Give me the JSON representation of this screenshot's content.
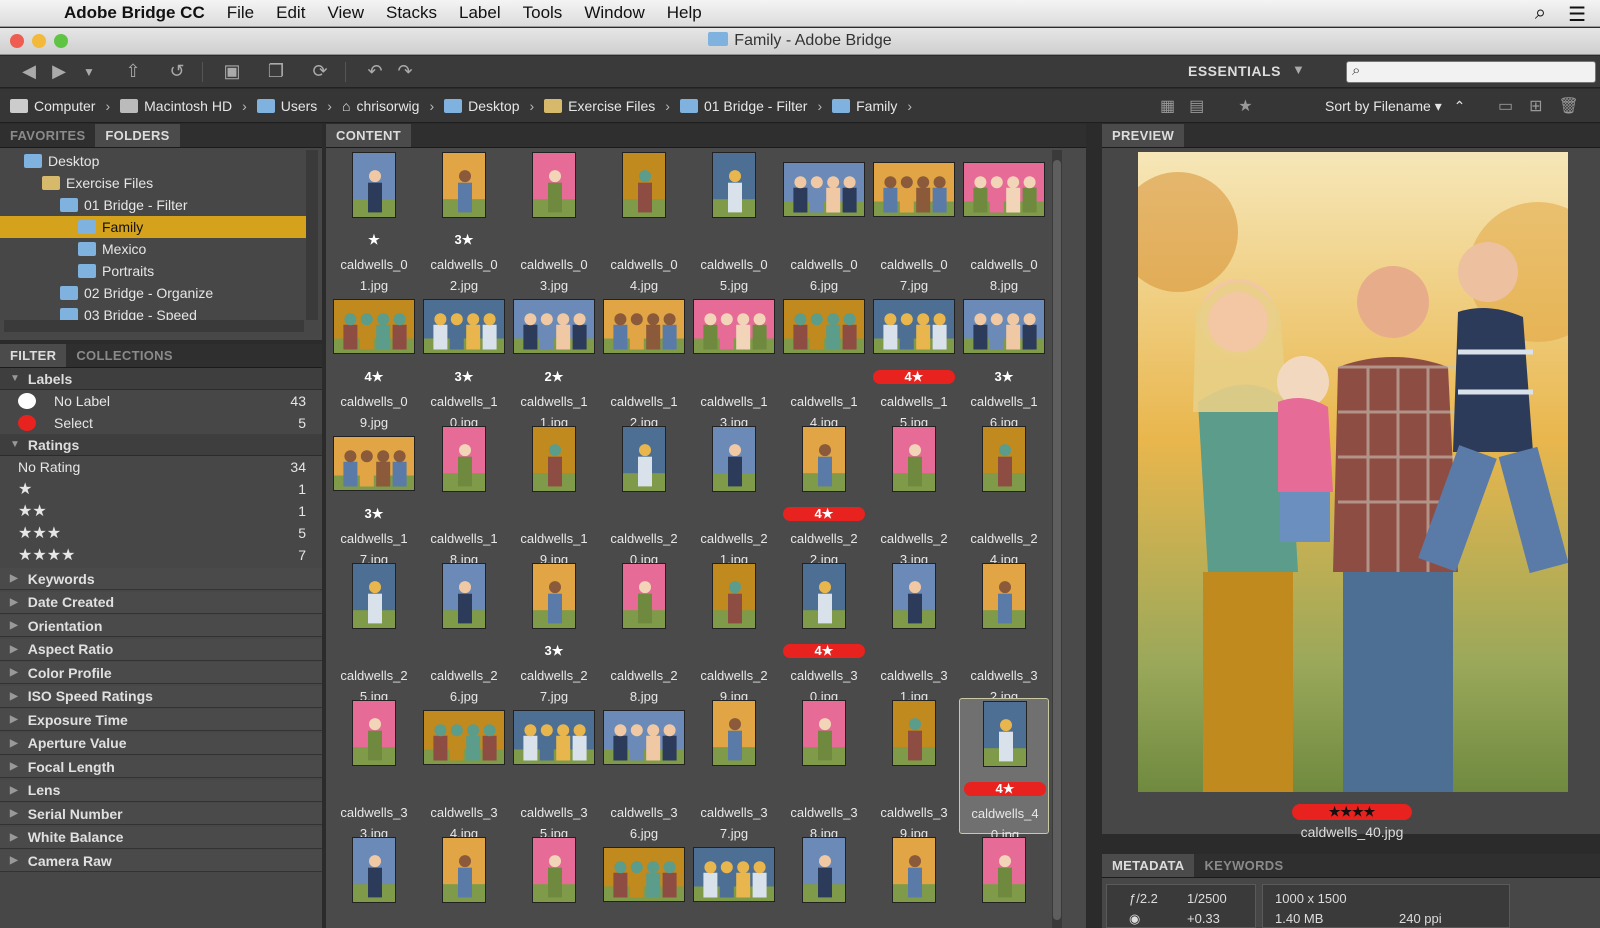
{
  "menubar": {
    "app_name": "Adobe Bridge CC",
    "items": [
      "File",
      "Edit",
      "View",
      "Stacks",
      "Label",
      "Tools",
      "Window",
      "Help"
    ]
  },
  "window": {
    "title": "Family - Adobe Bridge"
  },
  "toolbar": {
    "workspace": "ESSENTIALS",
    "search_value": ""
  },
  "path": [
    "Computer",
    "Macintosh HD",
    "Users",
    "chrisorwig",
    "Desktop",
    "Exercise Files",
    "01 Bridge - Filter",
    "Family"
  ],
  "sort_label": "Sort by Filename",
  "left_top": {
    "tabs": [
      "FAVORITES",
      "FOLDERS"
    ],
    "tree": [
      {
        "label": "Desktop",
        "indent": 0
      },
      {
        "label": "Exercise Files",
        "indent": 1
      },
      {
        "label": "01 Bridge - Filter",
        "indent": 2
      },
      {
        "label": "Family",
        "indent": 3,
        "selected": true
      },
      {
        "label": "Mexico",
        "indent": 3
      },
      {
        "label": "Portraits",
        "indent": 3
      },
      {
        "label": "02 Bridge - Organize",
        "indent": 2
      },
      {
        "label": "03 Bridge - Speed",
        "indent": 2
      }
    ]
  },
  "filter": {
    "tabs": [
      "FILTER",
      "COLLECTIONS"
    ],
    "labels_heading": "Labels",
    "labels": [
      {
        "label": "No Label",
        "count": "43",
        "color": "#ffffff"
      },
      {
        "label": "Select",
        "count": "5",
        "color": "#e8221e"
      }
    ],
    "ratings_heading": "Ratings",
    "ratings": [
      {
        "label": "No Rating",
        "count": "34"
      },
      {
        "label": "★",
        "count": "1"
      },
      {
        "label": "★★",
        "count": "1"
      },
      {
        "label": "★★★",
        "count": "5"
      },
      {
        "label": "★★★★",
        "count": "7"
      }
    ],
    "categories": [
      "Keywords",
      "Date Created",
      "Orientation",
      "Aspect Ratio",
      "Color Profile",
      "ISO Speed Ratings",
      "Exposure Time",
      "Aperture Value",
      "Focal Length",
      "Lens",
      "Serial Number",
      "White Balance",
      "Camera Raw"
    ]
  },
  "content": {
    "tab": "CONTENT",
    "items": [
      {
        "l1": "caldwells_0",
        "l2": "1.jpg",
        "rating": "★",
        "red": false,
        "o": "p"
      },
      {
        "l1": "caldwells_0",
        "l2": "2.jpg",
        "rating": "3★",
        "red": false,
        "o": "p"
      },
      {
        "l1": "caldwells_0",
        "l2": "3.jpg",
        "rating": "",
        "red": false,
        "o": "p"
      },
      {
        "l1": "caldwells_0",
        "l2": "4.jpg",
        "rating": "",
        "red": false,
        "o": "p"
      },
      {
        "l1": "caldwells_0",
        "l2": "5.jpg",
        "rating": "",
        "red": false,
        "o": "p"
      },
      {
        "l1": "caldwells_0",
        "l2": "6.jpg",
        "rating": "",
        "red": false,
        "o": "l"
      },
      {
        "l1": "caldwells_0",
        "l2": "7.jpg",
        "rating": "",
        "red": false,
        "o": "l"
      },
      {
        "l1": "caldwells_0",
        "l2": "8.jpg",
        "rating": "",
        "red": false,
        "o": "l"
      },
      {
        "l1": "caldwells_0",
        "l2": "9.jpg",
        "rating": "4★",
        "red": false,
        "o": "l"
      },
      {
        "l1": "caldwells_1",
        "l2": "0.jpg",
        "rating": "3★",
        "red": false,
        "o": "l"
      },
      {
        "l1": "caldwells_1",
        "l2": "1.jpg",
        "rating": "2★",
        "red": false,
        "o": "l"
      },
      {
        "l1": "caldwells_1",
        "l2": "2.jpg",
        "rating": "",
        "red": false,
        "o": "l"
      },
      {
        "l1": "caldwells_1",
        "l2": "3.jpg",
        "rating": "",
        "red": false,
        "o": "l"
      },
      {
        "l1": "caldwells_1",
        "l2": "4.jpg",
        "rating": "",
        "red": false,
        "o": "l"
      },
      {
        "l1": "caldwells_1",
        "l2": "5.jpg",
        "rating": "4★",
        "red": true,
        "o": "l"
      },
      {
        "l1": "caldwells_1",
        "l2": "6.jpg",
        "rating": "3★",
        "red": false,
        "o": "l"
      },
      {
        "l1": "caldwells_1",
        "l2": "7.jpg",
        "rating": "3★",
        "red": false,
        "o": "l"
      },
      {
        "l1": "caldwells_1",
        "l2": "8.jpg",
        "rating": "",
        "red": false,
        "o": "p"
      },
      {
        "l1": "caldwells_1",
        "l2": "9.jpg",
        "rating": "",
        "red": false,
        "o": "p"
      },
      {
        "l1": "caldwells_2",
        "l2": "0.jpg",
        "rating": "",
        "red": false,
        "o": "p"
      },
      {
        "l1": "caldwells_2",
        "l2": "1.jpg",
        "rating": "",
        "red": false,
        "o": "p"
      },
      {
        "l1": "caldwells_2",
        "l2": "2.jpg",
        "rating": "4★",
        "red": true,
        "o": "p"
      },
      {
        "l1": "caldwells_2",
        "l2": "3.jpg",
        "rating": "",
        "red": false,
        "o": "p"
      },
      {
        "l1": "caldwells_2",
        "l2": "4.jpg",
        "rating": "",
        "red": false,
        "o": "p"
      },
      {
        "l1": "caldwells_2",
        "l2": "5.jpg",
        "rating": "",
        "red": false,
        "o": "p"
      },
      {
        "l1": "caldwells_2",
        "l2": "6.jpg",
        "rating": "",
        "red": false,
        "o": "p"
      },
      {
        "l1": "caldwells_2",
        "l2": "7.jpg",
        "rating": "3★",
        "red": false,
        "o": "p"
      },
      {
        "l1": "caldwells_2",
        "l2": "8.jpg",
        "rating": "",
        "red": false,
        "o": "p"
      },
      {
        "l1": "caldwells_2",
        "l2": "9.jpg",
        "rating": "",
        "red": false,
        "o": "p"
      },
      {
        "l1": "caldwells_3",
        "l2": "0.jpg",
        "rating": "4★",
        "red": true,
        "o": "p"
      },
      {
        "l1": "caldwells_3",
        "l2": "1.jpg",
        "rating": "",
        "red": false,
        "o": "p"
      },
      {
        "l1": "caldwells_3",
        "l2": "2.jpg",
        "rating": "",
        "red": false,
        "o": "p"
      },
      {
        "l1": "caldwells_3",
        "l2": "3.jpg",
        "rating": "",
        "red": false,
        "o": "p"
      },
      {
        "l1": "caldwells_3",
        "l2": "4.jpg",
        "rating": "",
        "red": false,
        "o": "l"
      },
      {
        "l1": "caldwells_3",
        "l2": "5.jpg",
        "rating": "",
        "red": false,
        "o": "l"
      },
      {
        "l1": "caldwells_3",
        "l2": "6.jpg",
        "rating": "",
        "red": false,
        "o": "l"
      },
      {
        "l1": "caldwells_3",
        "l2": "7.jpg",
        "rating": "",
        "red": false,
        "o": "p"
      },
      {
        "l1": "caldwells_3",
        "l2": "8.jpg",
        "rating": "",
        "red": false,
        "o": "p"
      },
      {
        "l1": "caldwells_3",
        "l2": "9.jpg",
        "rating": "",
        "red": false,
        "o": "p"
      },
      {
        "l1": "caldwells_4",
        "l2": "0.jpg",
        "rating": "4★",
        "red": true,
        "o": "p",
        "selected": true
      },
      {
        "l1": "",
        "l2": "",
        "rating": "",
        "red": false,
        "o": "p"
      },
      {
        "l1": "",
        "l2": "",
        "rating": "",
        "red": false,
        "o": "p"
      },
      {
        "l1": "",
        "l2": "",
        "rating": "",
        "red": false,
        "o": "p"
      },
      {
        "l1": "",
        "l2": "",
        "rating": "",
        "red": false,
        "o": "l"
      },
      {
        "l1": "",
        "l2": "",
        "rating": "",
        "red": false,
        "o": "l"
      },
      {
        "l1": "",
        "l2": "",
        "rating": "",
        "red": false,
        "o": "p"
      },
      {
        "l1": "",
        "l2": "",
        "rating": "",
        "red": false,
        "o": "p"
      },
      {
        "l1": "",
        "l2": "",
        "rating": "",
        "red": false,
        "o": "p"
      }
    ]
  },
  "preview": {
    "tab": "PREVIEW",
    "rating": "★★★★",
    "filename": "caldwells_40.jpg"
  },
  "metadata": {
    "tabs": [
      "METADATA",
      "KEYWORDS"
    ],
    "aperture": "ƒ/2.2",
    "shutter": "1/2500",
    "exposure_comp": "+0.33",
    "dimensions": "1000 x 1500",
    "size": "1.40 MB",
    "ppi": "240 ppi"
  },
  "colors": {
    "selected_folder": "#d5a21c",
    "label_red": "#e8221e",
    "folder_blue": "#7fb2de"
  }
}
